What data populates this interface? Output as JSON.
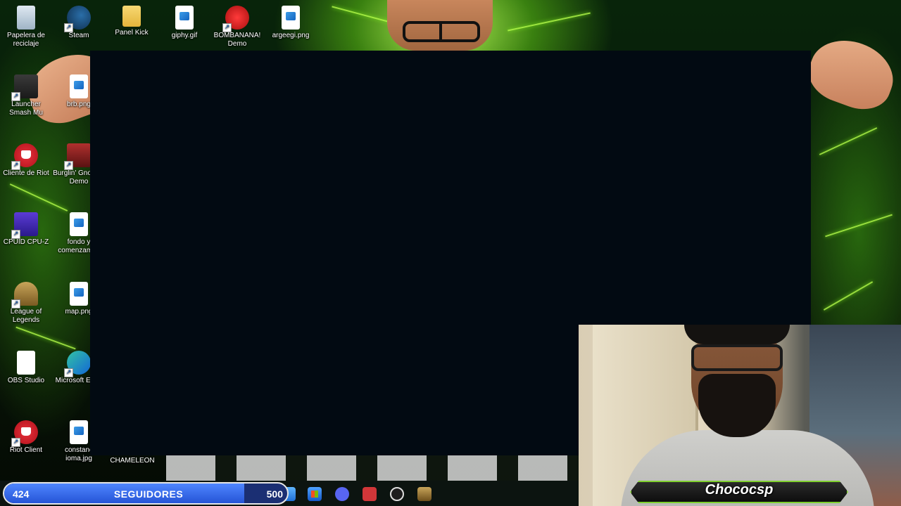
{
  "desktop": {
    "icons": [
      {
        "label": "Papelera de reciclaje",
        "icon": "recycle-bin-icon"
      },
      {
        "label": "Steam",
        "icon": "steam-icon"
      },
      {
        "label": "Panel Kick",
        "icon": "folder-icon"
      },
      {
        "label": "giphy.gif",
        "icon": "image-file-icon"
      },
      {
        "label": "BOMBANANA! Demo",
        "icon": "bombanana-icon"
      },
      {
        "label": "argeegi.png",
        "icon": "image-file-icon"
      },
      {
        "label": "Launcher Smash Mu",
        "icon": "smash-launcher-icon"
      },
      {
        "label": "brb.png",
        "icon": "image-file-icon"
      },
      {
        "label": "Cliente de Riot",
        "icon": "riot-client-icon"
      },
      {
        "label": "Burglin' Gnomes Demo",
        "icon": "burglin-gnomes-icon"
      },
      {
        "label": "CPUID CPU-Z",
        "icon": "cpuz-icon"
      },
      {
        "label": "fondo y comenzamos",
        "icon": "image-file-icon"
      },
      {
        "label": "League of Legends",
        "icon": "league-of-legends-icon"
      },
      {
        "label": "map.png",
        "icon": "image-file-icon"
      },
      {
        "label": "OBS Studio",
        "icon": "obs-studio-icon"
      },
      {
        "label": "Microsoft Edge",
        "icon": "edge-icon"
      },
      {
        "label": "Riot Client",
        "icon": "riot-client-icon"
      },
      {
        "label": "constanc ioma.jpg",
        "icon": "image-file-icon"
      },
      {
        "label": "CHAMELEON",
        "icon": "chameleon-icon"
      }
    ]
  },
  "overlay": {
    "followers": {
      "count": "424",
      "label": "SEGUIDORES",
      "goal": "500",
      "progress_fraction": 0.848
    },
    "streamer_name": "Chococsp"
  },
  "taskbar": {
    "icons": [
      "file-explorer-icon",
      "app-icon",
      "microsoft-store-icon",
      "discord-icon",
      "riot-client-icon",
      "obs-icon",
      "league-of-legends-icon"
    ]
  },
  "colors": {
    "capture_window": "#020a12",
    "followers_bar": "#2554d6",
    "accent_green": "#7fd02e"
  }
}
